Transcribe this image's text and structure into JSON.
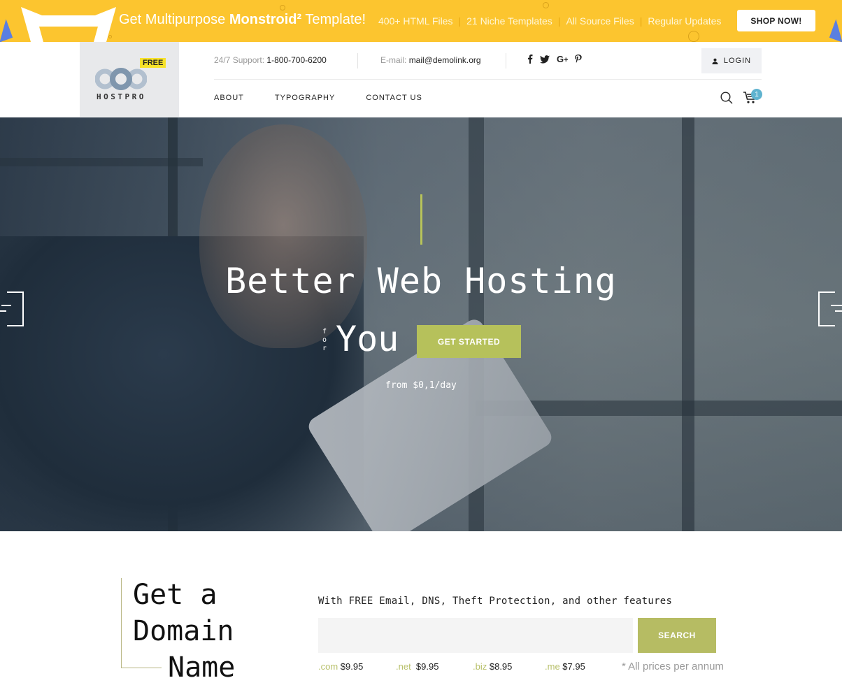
{
  "promo": {
    "title_prefix": "Get Multipurpose ",
    "title_brand": "Monstroid²",
    "title_suffix": " Template!",
    "features": [
      "400+ HTML Files",
      "21 Niche Templates",
      "All Source Files",
      "Regular Updates"
    ],
    "separator": "|",
    "shop_label": "SHOP NOW!",
    "accent_color": "#fcc52f"
  },
  "header": {
    "logo": {
      "name": "HOSTPRO",
      "badge": "FREE"
    },
    "support_label": "24/7 Support:",
    "support_value": "1-800-700-6200",
    "email_label": "E-mail:",
    "email_value": "mail@demolink.org",
    "socials": [
      {
        "icon": "facebook-icon",
        "glyph": "f"
      },
      {
        "icon": "twitter-icon",
        "glyph": "🐦"
      },
      {
        "icon": "google-plus-icon",
        "glyph": "G+"
      },
      {
        "icon": "pinterest-icon",
        "glyph": "P"
      }
    ],
    "login_label": "LOGIN",
    "nav": [
      "ABOUT",
      "TYPOGRAPHY",
      "CONTACT US"
    ],
    "cart_count": "1"
  },
  "hero": {
    "title": "Better Web Hosting",
    "for_text": [
      "f",
      "o",
      "r"
    ],
    "you_text": "You",
    "cta_label": "GET STARTED",
    "price_text": "from $0,1/day",
    "accent_color": "#b6c15b"
  },
  "domain": {
    "title_lines": [
      "Get a",
      "Domain",
      "Name"
    ],
    "subtitle": "With FREE Email, DNS, Theft Protection, and other features",
    "input_value": "",
    "input_placeholder": "",
    "search_label": "SEARCH",
    "tlds": [
      {
        "ext": ".com",
        "price": "$9.95"
      },
      {
        "ext": ".net",
        "price": "$9.95"
      },
      {
        "ext": ".biz",
        "price": "$8.95"
      },
      {
        "ext": ".me",
        "price": "$7.95"
      }
    ],
    "note": "* All prices per annum"
  }
}
